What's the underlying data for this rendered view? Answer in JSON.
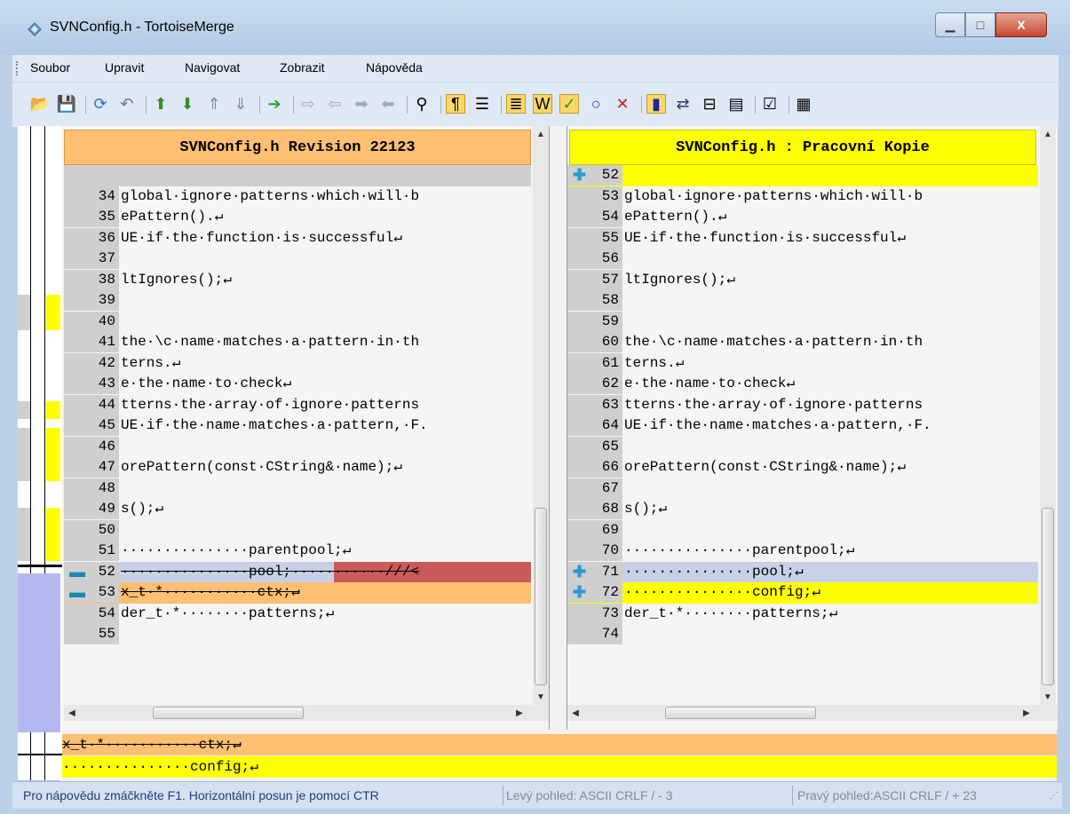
{
  "window": {
    "title": "SVNConfig.h - TortoiseMerge",
    "minimize_glyph": "▁",
    "maximize_glyph": "□",
    "close_glyph": "X"
  },
  "menu": [
    "Soubor",
    "Upravit",
    "Navigovat",
    "Zobrazit",
    "Nápověda"
  ],
  "toolbar": {
    "icons": [
      {
        "name": "open-icon",
        "glyph": "📂"
      },
      {
        "name": "save-icon",
        "glyph": "💾"
      },
      {
        "sep": true
      },
      {
        "name": "reload-icon",
        "glyph": "⟳"
      },
      {
        "name": "undo-icon",
        "glyph": "↶"
      },
      {
        "sep": true
      },
      {
        "name": "prev-difference-icon",
        "glyph": "⬆"
      },
      {
        "name": "next-difference-icon",
        "glyph": "⬇"
      },
      {
        "name": "first-difference-icon",
        "glyph": "⇑"
      },
      {
        "name": "last-difference-icon",
        "glyph": "⇓"
      },
      {
        "sep": true
      },
      {
        "name": "next-conflict-icon",
        "glyph": "➔"
      },
      {
        "sep": true
      },
      {
        "name": "use-theirs-icon",
        "glyph": "⇨"
      },
      {
        "name": "use-mine-icon",
        "glyph": "⇦"
      },
      {
        "name": "use-theirs-before-mine-icon",
        "glyph": "➡"
      },
      {
        "name": "use-mine-before-theirs-icon",
        "glyph": "⬅"
      },
      {
        "sep": true
      },
      {
        "name": "mark-icon",
        "glyph": "⚲"
      },
      {
        "sep": true
      },
      {
        "name": "whitespace-toggle-icon",
        "glyph": "¶",
        "active": true
      },
      {
        "name": "line-wrap-icon",
        "glyph": "☰"
      },
      {
        "sep": true
      },
      {
        "name": "inline-diff-icon",
        "glyph": "≣",
        "active": true
      },
      {
        "name": "word-diff-icon",
        "glyph": "W",
        "active": true
      },
      {
        "name": "mark-resolved-icon",
        "glyph": "✓",
        "active": true
      },
      {
        "name": "circle-icon",
        "glyph": "○"
      },
      {
        "name": "reject-icon",
        "glyph": "✕"
      },
      {
        "sep": true
      },
      {
        "name": "one-pane-view-icon",
        "glyph": "▮",
        "active": true
      },
      {
        "name": "swap-panes-icon",
        "glyph": "⇄"
      },
      {
        "name": "locator-bar-icon",
        "glyph": "⊟"
      },
      {
        "name": "diff-bar-icon",
        "glyph": "▤"
      },
      {
        "sep": true
      },
      {
        "name": "settings-icon",
        "glyph": "☑"
      },
      {
        "sep": true
      },
      {
        "name": "options-icon",
        "glyph": "▦"
      }
    ]
  },
  "left_pane": {
    "header": "SVNConfig.h Revision 22123",
    "lines": [
      {
        "num": "",
        "text": "",
        "state": "empty"
      },
      {
        "num": "34",
        "text": "global·ignore·patterns·which·will·b",
        "state": "normal"
      },
      {
        "num": "35",
        "text": "ePattern().↵",
        "state": "normal"
      },
      {
        "num": "36",
        "text": "UE·if·the·function·is·successful↵",
        "state": "normal"
      },
      {
        "num": "37",
        "text": "",
        "state": "normal"
      },
      {
        "num": "38",
        "text": "ltIgnores();↵",
        "state": "normal"
      },
      {
        "num": "39",
        "text": "",
        "state": "normal"
      },
      {
        "num": "40",
        "text": "",
        "state": "normal"
      },
      {
        "num": "41",
        "text": "the·\\c·name·matches·a·pattern·in·th",
        "state": "normal"
      },
      {
        "num": "42",
        "text": "terns.↵",
        "state": "normal"
      },
      {
        "num": "43",
        "text": "e·the·name·to·check↵",
        "state": "normal"
      },
      {
        "num": "44",
        "text": "tterns·the·array·of·ignore·patterns",
        "state": "normal"
      },
      {
        "num": "45",
        "text": "UE·if·the·name·matches·a·pattern,·F.",
        "state": "normal"
      },
      {
        "num": "46",
        "text": "",
        "state": "normal"
      },
      {
        "num": "47",
        "text": "orePattern(const·CString&·name);↵",
        "state": "normal"
      },
      {
        "num": "48",
        "text": "",
        "state": "normal"
      },
      {
        "num": "49",
        "text": "s();↵",
        "state": "normal"
      },
      {
        "num": "50",
        "text": "",
        "state": "normal"
      },
      {
        "num": "51",
        "text": "···············parentpool;↵",
        "state": "normal"
      },
      {
        "num": "52",
        "text": "···············pool;···········///<",
        "state": "removed",
        "marker": "minus"
      },
      {
        "num": "53",
        "text": "x_t·*···········ctx;↵",
        "state": "conflict",
        "marker": "minus"
      },
      {
        "num": "54",
        "text": "der_t·*········patterns;↵",
        "state": "normal"
      },
      {
        "num": "55",
        "text": "",
        "state": "normal"
      }
    ]
  },
  "right_pane": {
    "header": "SVNConfig.h : Pracovní Kopie",
    "lines": [
      {
        "num": "52",
        "text": "",
        "state": "added",
        "marker": "plus"
      },
      {
        "num": "53",
        "text": "global·ignore·patterns·which·will·b",
        "state": "normal"
      },
      {
        "num": "54",
        "text": "ePattern().↵",
        "state": "normal"
      },
      {
        "num": "55",
        "text": "UE·if·the·function·is·successful↵",
        "state": "normal"
      },
      {
        "num": "56",
        "text": "",
        "state": "normal"
      },
      {
        "num": "57",
        "text": "ltIgnores();↵",
        "state": "normal"
      },
      {
        "num": "58",
        "text": "",
        "state": "normal"
      },
      {
        "num": "59",
        "text": "",
        "state": "normal"
      },
      {
        "num": "60",
        "text": "the·\\c·name·matches·a·pattern·in·th",
        "state": "normal"
      },
      {
        "num": "61",
        "text": "terns.↵",
        "state": "normal"
      },
      {
        "num": "62",
        "text": "e·the·name·to·check↵",
        "state": "normal"
      },
      {
        "num": "63",
        "text": "tterns·the·array·of·ignore·patterns",
        "state": "normal"
      },
      {
        "num": "64",
        "text": "UE·if·the·name·matches·a·pattern,·F.",
        "state": "normal"
      },
      {
        "num": "65",
        "text": "",
        "state": "normal"
      },
      {
        "num": "66",
        "text": "orePattern(const·CString&·name);↵",
        "state": "normal"
      },
      {
        "num": "67",
        "text": "",
        "state": "normal"
      },
      {
        "num": "68",
        "text": "s();↵",
        "state": "normal"
      },
      {
        "num": "69",
        "text": "",
        "state": "normal"
      },
      {
        "num": "70",
        "text": "···············parentpool;↵",
        "state": "normal"
      },
      {
        "num": "71",
        "text": "···············pool;↵",
        "state": "changed",
        "marker": "plus"
      },
      {
        "num": "72",
        "text": "···············config;↵",
        "state": "added",
        "marker": "plus"
      },
      {
        "num": "73",
        "text": "der_t·*········patterns;↵",
        "state": "normal"
      },
      {
        "num": "74",
        "text": "",
        "state": "normal"
      }
    ]
  },
  "bottom_diff": {
    "line1": "x_t·*···········ctx;↵",
    "line2": "···············config;↵"
  },
  "status": {
    "help": "Pro nápovědu zmáčkněte F1. Horizontální posun je pomocí CTR",
    "left_view": "Levý pohled: ASCII CRLF  / - 3",
    "right_view": "Pravý pohled:ASCII CRLF  / + 23"
  },
  "colors": {
    "header_left": "#fdbf71",
    "header_right": "#ffff00",
    "removed": "#c8d0e8",
    "removed_tail": "#c85a5a",
    "conflict": "#fdbf71",
    "added": "#ffff00",
    "changed": "#c8d0e8",
    "gutter": "#cfcfcf",
    "normal": "#f5f5f5",
    "empty": "#cfcfcf"
  }
}
